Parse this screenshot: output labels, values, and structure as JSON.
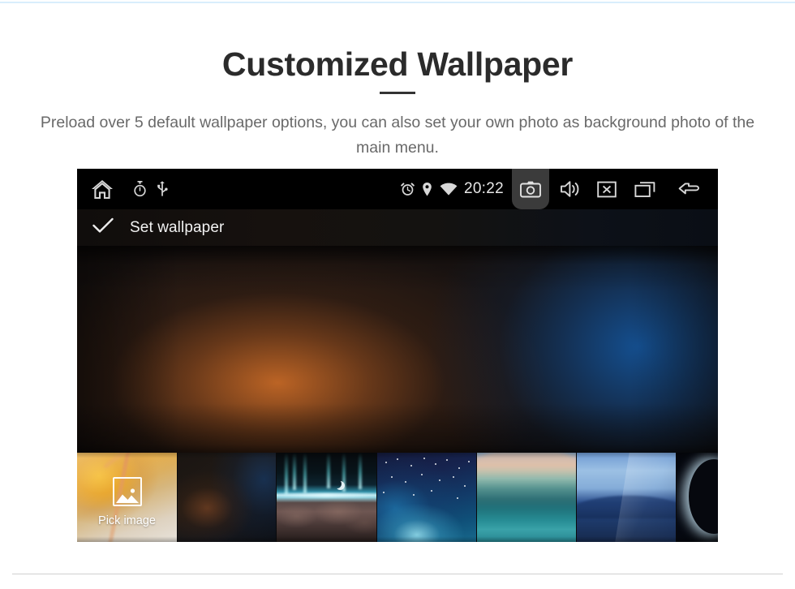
{
  "page": {
    "heading": "Customized Wallpaper",
    "subheading": "Preload over 5 default wallpaper options, you can also set your own photo as background photo of the main menu.",
    "accent_rule_color": "#333333",
    "top_rule_color": "#d9eefc",
    "bottom_rule_color": "#cfcfcf",
    "heading_color": "#2b2b2b",
    "subheading_color": "#696969"
  },
  "device": {
    "statusbar": {
      "background": "#000000",
      "left_icons": [
        {
          "name": "home-icon",
          "label": "Home"
        },
        {
          "name": "stopwatch-icon",
          "label": "Timer"
        },
        {
          "name": "usb-icon",
          "label": "USB"
        }
      ],
      "right_icons": [
        {
          "name": "alarm-clock-icon",
          "label": "Alarm"
        },
        {
          "name": "location-pin-icon",
          "label": "Location"
        },
        {
          "name": "wifi-icon",
          "label": "Wi-Fi"
        }
      ],
      "clock": "20:22",
      "nav_icons": [
        {
          "name": "camera-icon",
          "label": "Screenshot",
          "highlighted": true,
          "highlight_color": "#3b3b3b"
        },
        {
          "name": "volume-icon",
          "label": "Volume"
        },
        {
          "name": "close-box-icon",
          "label": "Close"
        },
        {
          "name": "recents-icon",
          "label": "Recent apps"
        },
        {
          "name": "back-arrow-icon",
          "label": "Back"
        }
      ]
    },
    "actionbar": {
      "confirm_icon": "check-icon",
      "title": "Set wallpaper"
    },
    "preview": {
      "description": "Blurred wallpaper preview: warm orange glow at left of centre, deep blue glow at right"
    },
    "thumbnails": [
      {
        "id": "pick-image",
        "label": "Pick image",
        "icon": "image-picker-icon",
        "selected": true,
        "description": "Autumn leaves, orange and gold"
      },
      {
        "id": "wallpaper-1",
        "label": "",
        "description": "Dark blurred amber and navy bokeh"
      },
      {
        "id": "wallpaper-2",
        "label": "",
        "description": "Aurora over earth horizon with crescent moon"
      },
      {
        "id": "wallpaper-3",
        "label": "",
        "description": "Blue starfield nebula"
      },
      {
        "id": "wallpaper-4",
        "label": "",
        "description": "Pastel teal wave"
      },
      {
        "id": "wallpaper-5",
        "label": "",
        "description": "Blue abstract geometric gradient"
      },
      {
        "id": "wallpaper-6",
        "label": "",
        "description": "Earth limb glowing in deep space"
      }
    ]
  }
}
